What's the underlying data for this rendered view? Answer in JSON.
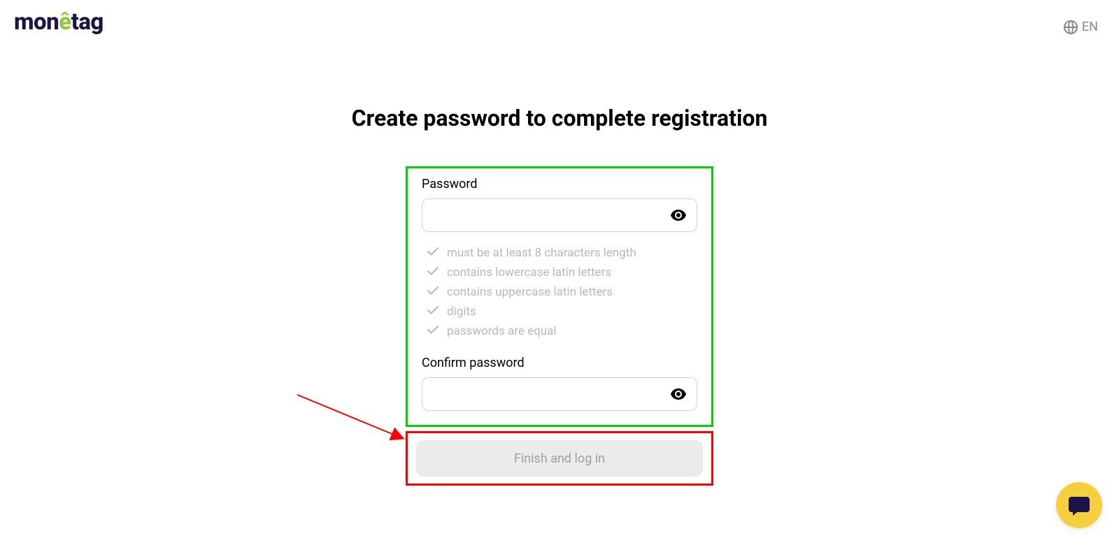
{
  "logo": {
    "text_before": "mon",
    "accent_char": "ê",
    "text_after": "tag"
  },
  "language": {
    "label": "EN"
  },
  "form": {
    "title": "Create password to complete registration",
    "password_label": "Password",
    "password_value": "",
    "confirm_label": "Confirm password",
    "confirm_value": "",
    "requirements": [
      "must be at least 8 characters length",
      "contains lowercase latin letters",
      "contains uppercase latin letters",
      "digits",
      "passwords are equal"
    ],
    "submit_label": "Finish and log in"
  },
  "annotations": {
    "form_highlight_color": "#00d400",
    "button_highlight_color": "#ff0000",
    "arrow_color": "#ff0000"
  }
}
